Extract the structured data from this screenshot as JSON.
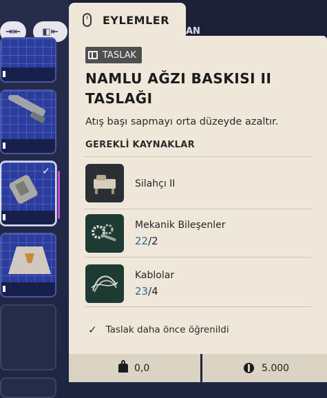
{
  "header": {
    "tab_label": "EYLEMLER",
    "ghost_text": "AN"
  },
  "blueprint": {
    "badge": "TASLAK",
    "title": "NAMLU AĞZI BASKISI II TASLAĞI",
    "description": "Atış başı sapmayı orta düzeyde azaltır.",
    "resources_heading": "GEREKLİ KAYNAKLAR",
    "resources": [
      {
        "name": "Silahçı II",
        "have": "",
        "need": "",
        "icon": "workbench-icon"
      },
      {
        "name": "Mekanik Bileşenler",
        "have": "22",
        "need": "/2",
        "icon": "gears-icon"
      },
      {
        "name": "Kablolar",
        "have": "23",
        "need": "/4",
        "icon": "wires-icon"
      }
    ],
    "learned_text": "Taslak daha önce öğrenildi"
  },
  "footer": {
    "weight": "0,0",
    "value": "5.000"
  },
  "colors": {
    "panel_bg": "#efe8da",
    "count_accent": "#2e6b8f",
    "grid_slot": "#2b3c9a"
  }
}
